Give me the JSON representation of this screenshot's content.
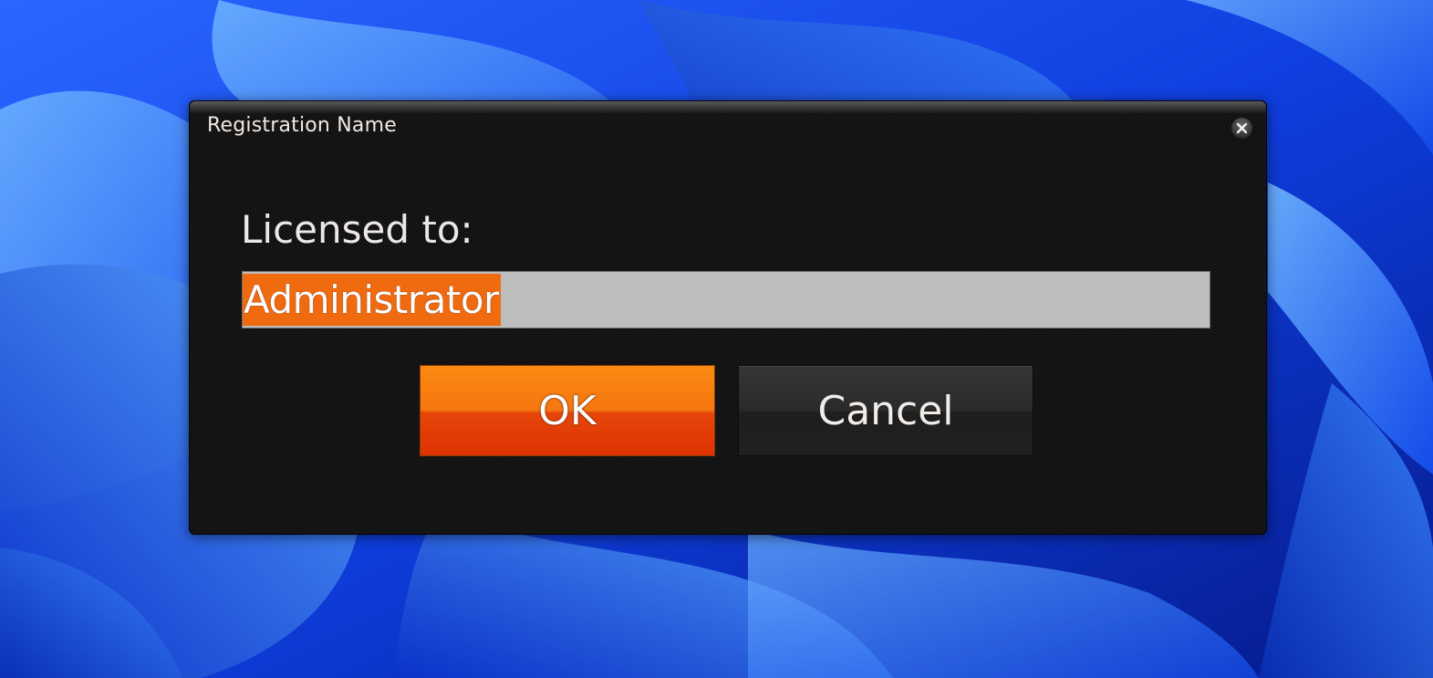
{
  "dialog": {
    "title": "Registration Name",
    "close_icon": "close-icon",
    "label": "Licensed to:",
    "input_value": "Administrator",
    "ok_label": "OK",
    "cancel_label": "Cancel"
  },
  "colors": {
    "accent": "#f06a10",
    "dialog_bg": "#1b1b1b",
    "input_bg": "#bdbdbd",
    "wallpaper": "#0a3fd8"
  }
}
